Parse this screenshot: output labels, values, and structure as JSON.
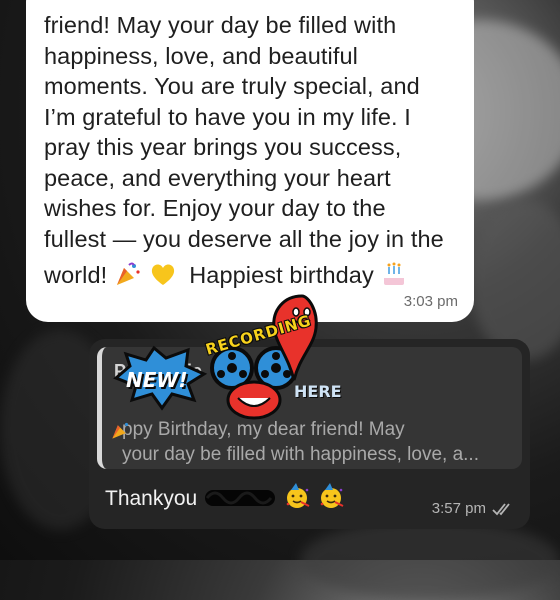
{
  "incoming_message": {
    "lines": [
      "friend! May your day be filled with",
      "happiness, love, and beautiful",
      "moments. You are truly special, and",
      "I’m grateful to have you in my life. I",
      "pray this year brings you success,",
      "peace, and everything your heart",
      "wishes for. Enjoy your day to the",
      "fullest — you deserve all the joy in the"
    ],
    "last_line_start": "world!",
    "last_line_end": "Happiest birthday",
    "time": "3:03 pm",
    "emojis": [
      "party-popper-icon",
      "yellow-heart-icon",
      "birthday-cake-icon"
    ]
  },
  "outgoing_message": {
    "quote": {
      "author": "Potato Pie",
      "line1": "ppy Birthday, my dear friend! May",
      "line2": "your day be filled with happiness, love, a..."
    },
    "reply_text": "Thankyou",
    "time": "3:57 pm",
    "status_icon": "double-check-icon",
    "emojis": [
      "partying-face-icon",
      "partying-face-icon"
    ]
  },
  "stickers": {
    "recording_text": "RECORDING",
    "new_text": "NEW!",
    "here_text": "HERE"
  },
  "colors": {
    "incoming_bubble": "#ffffff",
    "outgoing_bubble": "#252525",
    "quote_bg": "#353535",
    "sticker_red": "#e8322b",
    "sticker_blue": "#2f8fd8"
  }
}
